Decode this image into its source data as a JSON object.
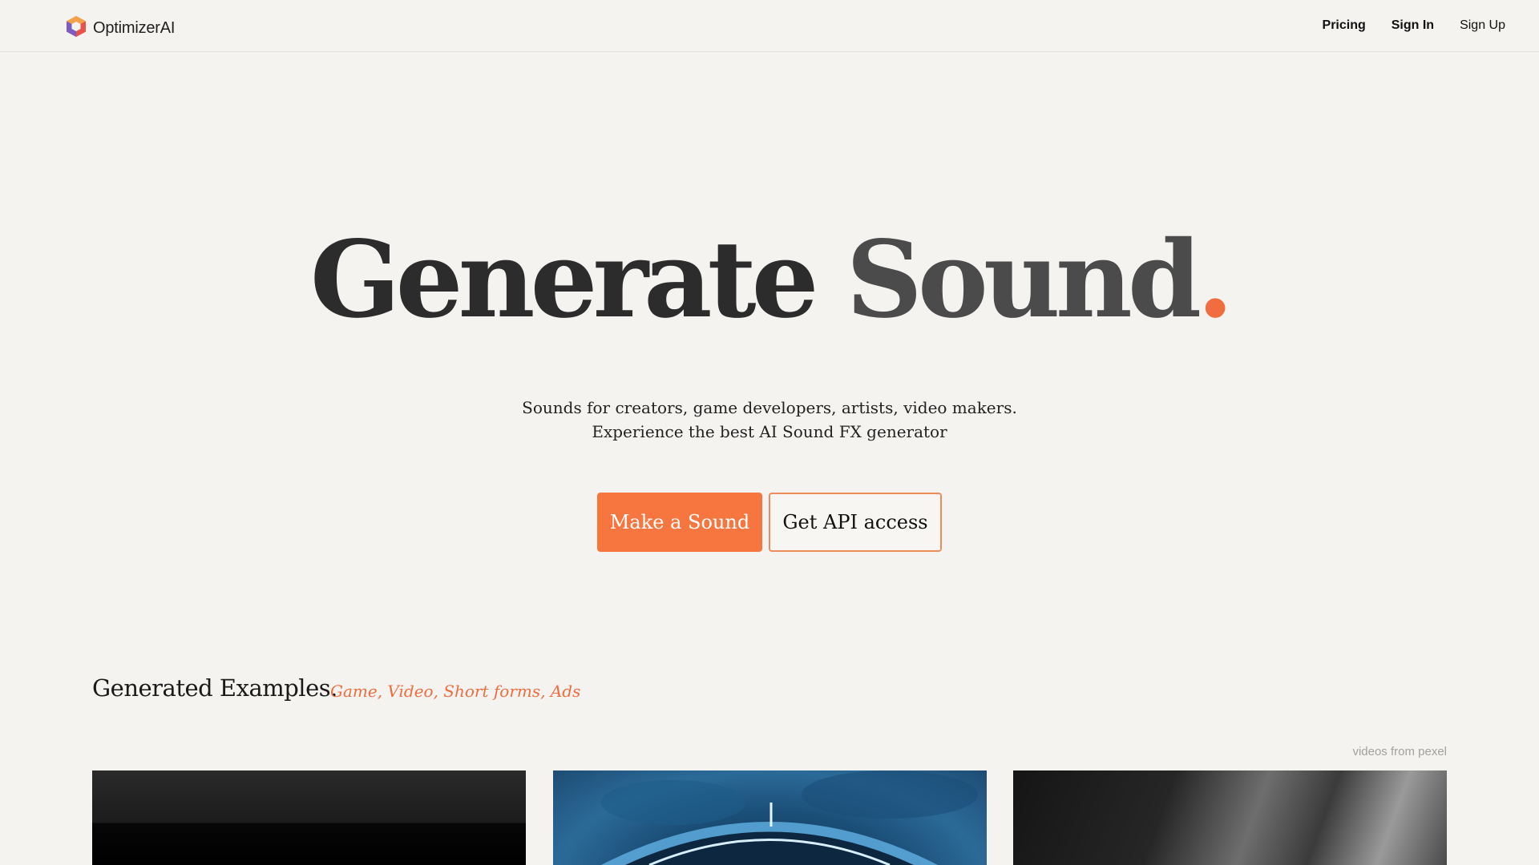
{
  "header": {
    "brand": "OptimizerAI",
    "logo_icon": "hexagon-cube-logo",
    "nav": [
      {
        "label": "Pricing"
      },
      {
        "label": "Sign In"
      },
      {
        "label": "Sign Up"
      }
    ]
  },
  "hero": {
    "title_word1": "Generate",
    "title_word2": "Sound",
    "title_dot": ".",
    "subtitle_line1": "Sounds for creators, game developers, artists, video makers.",
    "subtitle_line2": "Experience the best AI Sound FX generator",
    "primary_button": "Make a Sound",
    "secondary_button": "Get API access"
  },
  "examples": {
    "title": "Generated Examples.",
    "tags": "Game, Video, Short forms, Ads",
    "credit": "videos from pexel"
  },
  "colors": {
    "accent": "#f7763f",
    "background": "#f4f3f0",
    "text": "#2c2c2c"
  }
}
